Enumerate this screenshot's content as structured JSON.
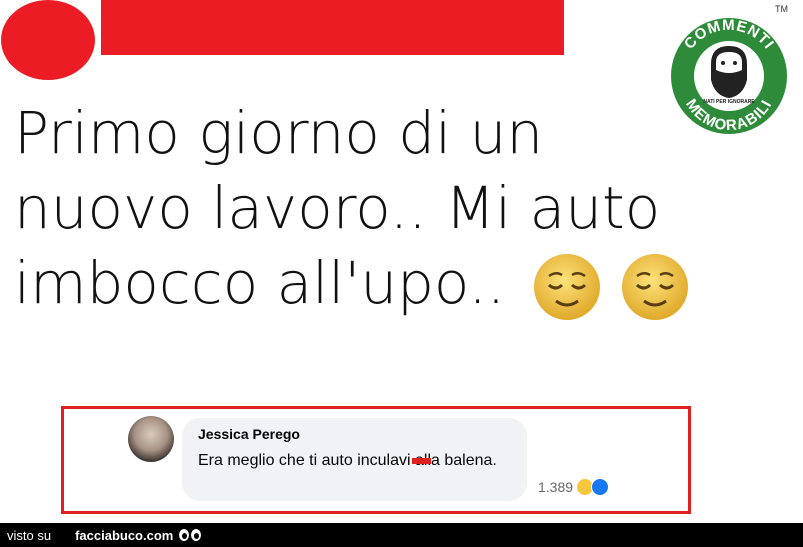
{
  "post": {
    "lines": [
      "Primo giorno di un",
      "nuovo lavoro.. Mi auto",
      "imbocco all'upo.."
    ]
  },
  "badge": {
    "top_text": "COMMENTI",
    "bottom_text": "MEMORABILI",
    "small_text": "NATI PER IGNORARE",
    "tm": "TM",
    "color": "#2e8b3a"
  },
  "comment": {
    "author": "Jessica Perego",
    "text": "Era meglio che ti auto inculavi alla balena.",
    "reaction_count": "1.389"
  },
  "footer": {
    "visto": "visto su",
    "site": "facciabuco.com"
  },
  "colors": {
    "redaction": "#ec1c24",
    "border": "#e02020"
  }
}
